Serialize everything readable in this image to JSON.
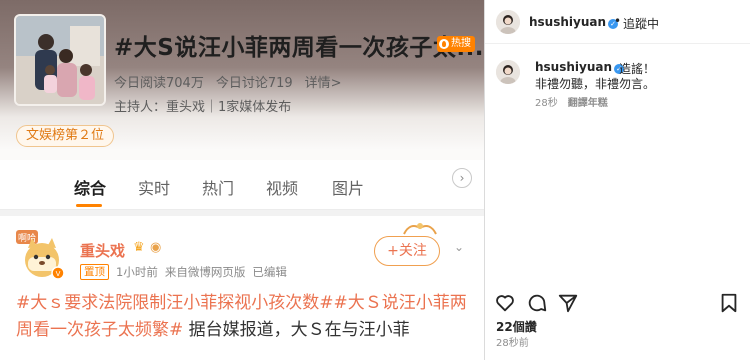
{
  "weibo": {
    "topic_title": "#大S说汪小菲两周看一次孩子太...",
    "hot_badge": "热搜",
    "read_count": "今日阅读704万",
    "discuss_count": "今日讨论719",
    "details_link": "详情>",
    "host": "主持人：重头戏｜1家媒体发布",
    "rank_tag": "文娱榜第２位",
    "tabs": [
      "综合",
      "实时",
      "热门",
      "视频",
      "图片"
    ],
    "active_tab": "综合",
    "post": {
      "avatar_label": "啊哈",
      "author": "重头戏",
      "pinned": "置顶",
      "time": "1小时前",
      "source": "来自微博网页版",
      "edited": "已编辑",
      "follow": "+关注",
      "text_tag1": "#大ｓ要求法院限制汪小菲探视小孩次数#",
      "text_tag2": "#大Ｓ说汪小菲两周看一次孩子太频繁#",
      "text_rest": " 据台媒报道，大Ｓ在与汪小菲"
    }
  },
  "instagram": {
    "header_user": "hsushiyuan",
    "header_follow": "追蹤中",
    "caption_user": "hsushiyuan",
    "caption_line1": "造謠！",
    "caption_line2": "非禮勿聽，非禮勿言。",
    "comment_time": "28秒",
    "translate": "翻譯年糕",
    "likes": "22個讚",
    "posted_ago": "28秒前"
  },
  "colors": {
    "weibo_orange": "#ff8200",
    "weibo_name": "#eb7350",
    "ig_verified": "#3897f0"
  }
}
